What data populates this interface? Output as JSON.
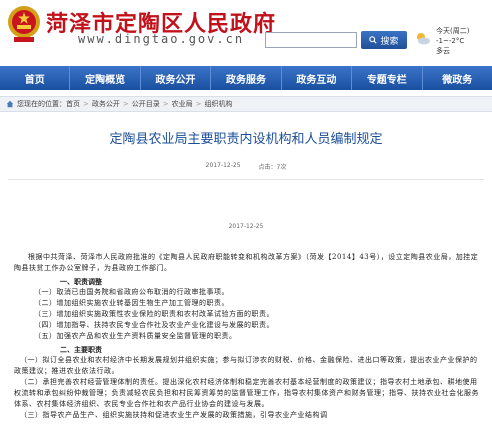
{
  "header": {
    "site_title": "菏泽市定陶区人民政府",
    "site_url": "www.dingtao.gov.cn",
    "search_button": "搜索",
    "weather": {
      "day": "今天(周二)",
      "temp": "-1~-2°C",
      "condition": "多云"
    }
  },
  "nav": {
    "items": [
      "首页",
      "定陶概览",
      "政务公开",
      "政务服务",
      "政务互动",
      "专题专栏",
      "微政务"
    ]
  },
  "breadcrumb": [
    "您现在的位置：首页",
    "政务公开",
    "公开目录",
    "农业局",
    "组织机构"
  ],
  "article": {
    "title": "定陶县农业局主要职责内设机构和人员编制规定",
    "date": "2017-12-25",
    "source": "点击：7次",
    "date2": "2017-12-25",
    "intro": "根据中共菏泽、菏泽市人民政府批准的《定陶县人民政府职能转变和机构改革方案》（菏发【2014】43号），设立定陶县农业局，加挂定陶县扶贫工作办公室牌子，为县政府工作部门。",
    "section1": "一、职责调整",
    "s1_items": [
      "（一）取消已由国务院和省政府公布取消的行政审批事项。",
      "（二）增加组织实施农业转基因生物生产加工管理的职责。",
      "（三）增加组织实施政策性农业保险的职责和农村改革试验方面的职责。",
      "（四）增加指导、扶持农民专业合作社及农业产业化建设与发展的职责。",
      "（五）加强农产品和农业生产资料质量安全监督管理的职责。"
    ],
    "section2": "二、主要职责",
    "s2_paras": [
      "（一）拟订全县农业和农村经济中长期发展规划并组织实施；参与拟订涉农的财税、价格、金融保险、进出口等政策，提出农业产业保护的政策建议；推进农业依法行政。",
      "（二）承担完善农村经营管理体制的责任。提出深化农村经济体制和稳定完善农村基本经营制度的政策建议；指导农村土地承包、耕地使用权流转和承包纠纷仲裁管理；负责减轻农民负担和村民筹资筹劳的监督管理工作，指导农村集体资产和财务管理；指导、扶持农业社会化服务体系、农村集体经济组织、农民专业合作社和农产品行业协会的建设与发展。",
      "（三）指导农产品生产、组织实施扶持和促进农业生产发展的政策措施，引导农业产业结构调"
    ]
  }
}
